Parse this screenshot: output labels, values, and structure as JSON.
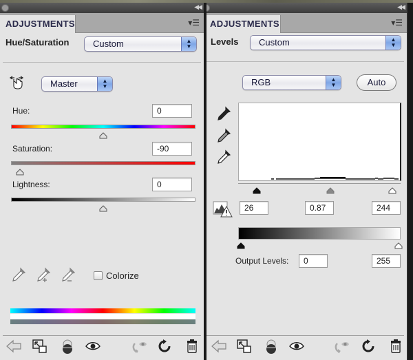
{
  "panels": {
    "left": {
      "tab_label": "ADJUSTMENTS",
      "adjustment_title": "Hue/Saturation",
      "preset_select": "Custom",
      "channel_select": "Master",
      "hue": {
        "label": "Hue:",
        "value": "0",
        "slider_fraction": 0.5
      },
      "saturation": {
        "label": "Saturation:",
        "value": "-90",
        "slider_fraction": 0.05
      },
      "lightness": {
        "label": "Lightness:",
        "value": "0",
        "slider_fraction": 0.5
      },
      "colorize": {
        "label": "Colorize",
        "checked": false
      },
      "icons": [
        "targeted-adjustment-hand-icon",
        "eyedropper-icon",
        "eyedropper-add-icon",
        "eyedropper-subtract-icon"
      ]
    },
    "right": {
      "tab_label": "ADJUSTMENTS",
      "adjustment_title": "Levels",
      "preset_select": "Custom",
      "channel_select": "RGB",
      "auto_button": "Auto",
      "input_levels": {
        "black": "26",
        "gamma": "0.87",
        "white": "244"
      },
      "output_levels": {
        "label": "Output Levels:",
        "black": "0",
        "white": "255"
      },
      "icons": [
        "black-point-eyedropper-icon",
        "gray-point-eyedropper-icon",
        "white-point-eyedropper-icon",
        "clipping-warning-icon"
      ]
    }
  },
  "footer_icons": [
    "back-arrow-icon",
    "expand-view-icon",
    "clip-to-layer-icon",
    "visibility-eye-icon",
    "view-previous-state-icon",
    "reset-icon",
    "trash-icon"
  ],
  "colors": {
    "panel_bg": "#e4e4e4",
    "select_accent": "#7fa6e6",
    "title_text": "#2a2a4a"
  }
}
